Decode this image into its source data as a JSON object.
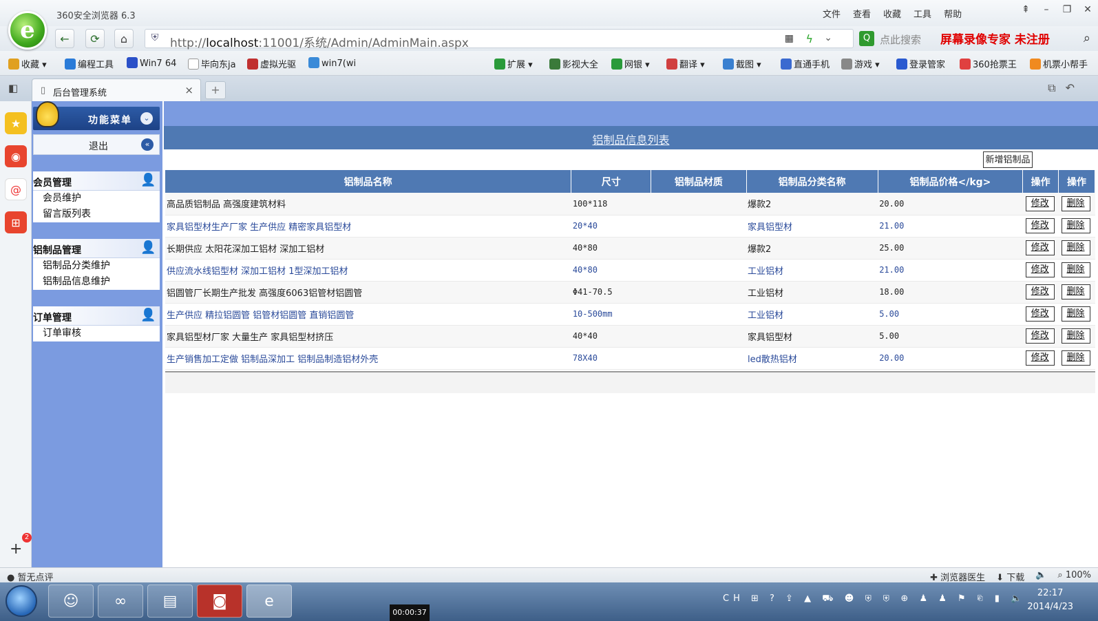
{
  "browser": {
    "app_title": "360安全浏览器 6.3",
    "menu": [
      "文件",
      "查看",
      "收藏",
      "工具",
      "帮助"
    ],
    "url_prefix": "http://",
    "url_host": "localhost",
    "url_rest": ":11001/系统/Admin/AdminMain.aspx",
    "search_placeholder": "点此搜索",
    "watermark": "屏幕录像专家  未注册"
  },
  "bookmarks": [
    {
      "label": "收藏",
      "color": "#e0a020"
    },
    {
      "label": "编程工具",
      "color": "#2a7bd8"
    },
    {
      "label": "Win7 64",
      "color": "#2a50c8"
    },
    {
      "label": "毕向东ja",
      "color": "#bbbbbb"
    },
    {
      "label": "虚拟光驱",
      "color": "#c03030"
    },
    {
      "label": "win7(wi",
      "color": "#3a8ad8"
    },
    {
      "label": "扩展",
      "color": "#2a9a3a"
    },
    {
      "label": "影视大全",
      "color": "#3a7a3a"
    },
    {
      "label": "网银",
      "color": "#2a9a3a"
    },
    {
      "label": "翻译",
      "color": "#d04040"
    },
    {
      "label": "截图",
      "color": "#3a80d0"
    },
    {
      "label": "直通手机",
      "color": "#3a6ad0"
    },
    {
      "label": "游戏",
      "color": "#888888"
    },
    {
      "label": "登录管家",
      "color": "#2a5ad0"
    },
    {
      "label": "360抢票王",
      "color": "#e04040"
    },
    {
      "label": "机票小帮手",
      "color": "#f08a20"
    }
  ],
  "tab": {
    "label": "后台管理系统",
    "close": "×",
    "new": "+"
  },
  "sidebar": {
    "header": "功能菜单",
    "logout": "退出",
    "groups": [
      {
        "title": "会员管理",
        "items": [
          "会员维护",
          "留言版列表"
        ]
      },
      {
        "title": "铝制品管理",
        "items": [
          "铝制品分类维护",
          "铝制品信息维护"
        ]
      },
      {
        "title": "订单管理",
        "items": [
          "订单审核"
        ]
      }
    ]
  },
  "main": {
    "caption": "铝制品信息列表",
    "add_button": "新增铝制品",
    "columns": [
      "铝制品名称",
      "尺寸",
      "铝制品材质",
      "铝制品分类名称",
      "铝制品价格</kg>",
      "操作",
      "操作"
    ],
    "edit_label": "修改",
    "delete_label": "删除",
    "rows": [
      {
        "name": "高品质铝制品 高强度建筑材料",
        "size": "100*118",
        "material": "",
        "category": "爆款2",
        "price": "20.00"
      },
      {
        "name": "家具铝型材生产厂家 生产供应 精密家具铝型材",
        "size": "20*40",
        "material": "",
        "category": "家具铝型材",
        "price": "21.00"
      },
      {
        "name": "长期供应 太阳花深加工铝材 深加工铝材",
        "size": "40*80",
        "material": "",
        "category": "爆款2",
        "price": "25.00"
      },
      {
        "name": "供应流水线铝型材 深加工铝材 1型深加工铝材",
        "size": "40*80",
        "material": "",
        "category": "工业铝材",
        "price": "21.00"
      },
      {
        "name": "铝圆管厂长期生产批发 高强度6063铝管材铝圆管",
        "size": "Φ41-70.5",
        "material": "",
        "category": "工业铝材",
        "price": "18.00"
      },
      {
        "name": "生产供应 精拉铝圆管 铝管材铝圆管 直销铝圆管",
        "size": "10-500mm",
        "material": "",
        "category": "工业铝材",
        "price": "5.00"
      },
      {
        "name": "家具铝型材厂家 大量生产 家具铝型材挤压",
        "size": "40*40",
        "material": "",
        "category": "家具铝型材",
        "price": "5.00"
      },
      {
        "name": "生产销售加工定做 铝制品深加工 铝制品制造铝材外壳",
        "size": "78X40",
        "material": "",
        "category": "led散热铝材",
        "price": "20.00"
      }
    ]
  },
  "status": {
    "left": "暂无点评",
    "doctor": "浏览器医生",
    "download": "下载",
    "zoom": "100%"
  },
  "taskbar": {
    "ime": "CH",
    "time": "22:17",
    "date": "2014/4/23",
    "recorder": "00:00:37"
  }
}
